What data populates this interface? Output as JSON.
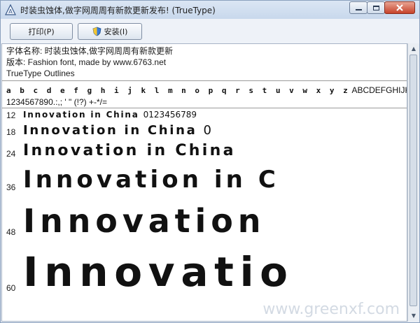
{
  "window": {
    "title": "时装虫蚀体,做字网周周有新款更新发布! (TrueType)"
  },
  "toolbar": {
    "print_label": "打印(P)",
    "install_label": "安装(I)"
  },
  "info": {
    "font_name": "字体名称: 时装虫蚀体,做字网周周有新款更新",
    "version": "版本: Fashion font, made by www.6763.net",
    "outlines": "TrueType Outlines"
  },
  "charset": {
    "lower_fancy": "a b c d e f g h i j k l m n o p q r s t u v w x y z",
    "upper": "ABCDEFGHIJKLMNOPQRSTUVWXYZ",
    "digits": "1234567890.:,; ' \" (!?) +-*/="
  },
  "samples": [
    {
      "size": "12",
      "text": "Innovation in China",
      "extra": "0123456789"
    },
    {
      "size": "18",
      "text": "Innovation in China",
      "extra": "0"
    },
    {
      "size": "24",
      "text": "Innovation in China",
      "extra": ""
    },
    {
      "size": "36",
      "text": "Innovation in C",
      "extra": ""
    },
    {
      "size": "48",
      "text": "Innovation",
      "extra": ""
    },
    {
      "size": "60",
      "text": "Innovatio",
      "extra": ""
    }
  ],
  "watermark": "www.greenxf.com"
}
